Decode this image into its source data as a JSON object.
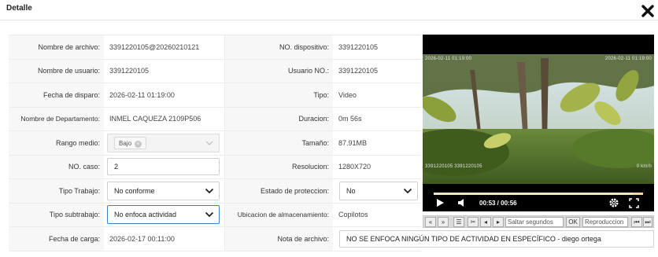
{
  "dialog": {
    "title": "Detalle"
  },
  "fields": {
    "nombre_archivo": {
      "label": "Nombre de archivo:",
      "value": "3391220105@20260210121"
    },
    "no_dispositivo": {
      "label": "NO. dispositivo:",
      "value": "3391220105"
    },
    "nombre_usuario": {
      "label": "Nombre de usuario:",
      "value": "3391220105"
    },
    "usuario_no": {
      "label": "Usuario NO.:",
      "value": "3391220105"
    },
    "fecha_disparo": {
      "label": "Fecha de disparo:",
      "value": "2026-02-11 01:19:00"
    },
    "tipo": {
      "label": "Tipo:",
      "value": "Video"
    },
    "departamento": {
      "label": "Nombre de Departamento:",
      "value": "INMEL CAQUEZA 2109P506"
    },
    "duracion": {
      "label": "Duracion:",
      "value": "0m 56s"
    },
    "rango_medio": {
      "label": "Rango medio:",
      "value": "Bajo"
    },
    "tamano": {
      "label": "Tamaño:",
      "value": "87.91MB"
    },
    "no_caso": {
      "label": "NO. caso:",
      "value": "2"
    },
    "resolucion": {
      "label": "Resolucion:",
      "value": "1280X720"
    },
    "tipo_trabajo": {
      "label": "Tipo Trabajo:",
      "value": "No conforme"
    },
    "estado_proteccion": {
      "label": "Estado de proteccion:",
      "value": "No"
    },
    "tipo_subtrabajo": {
      "label": "Tipo subtrabajo:",
      "value": "No enfoca actividad"
    },
    "ubicacion": {
      "label": "Ubicacion de almacenamiento:",
      "value": "Copilotos"
    },
    "fecha_carga": {
      "label": "Fecha de carga:",
      "value": "2026-02-17 00:11:00"
    },
    "nota_archivo": {
      "label": "Nota de archivo:",
      "value": "NO SE ENFOCA NINGÚN TIPO DE ACTIVIDAD EN ESPECÍFICO - diego ortega"
    }
  },
  "player": {
    "time_display": "00:53 / 00:56",
    "progress": 0.95,
    "osd_top_left": "2026-02-11 01:19:00",
    "osd_top_right": "2026-02-11 01:19:00",
    "osd_bottom_left": "3391220105 3391220105",
    "osd_bottom_right": "0 km/h"
  },
  "toolbar": {
    "seconds_placeholder": "Saltar segundos",
    "ok_label": "OK",
    "mode_label": "Reproduccion"
  },
  "colors": {
    "focus_border": "#3f7fc5",
    "label_bg": "#f7f7f7",
    "progress": "#f0d8a0"
  }
}
